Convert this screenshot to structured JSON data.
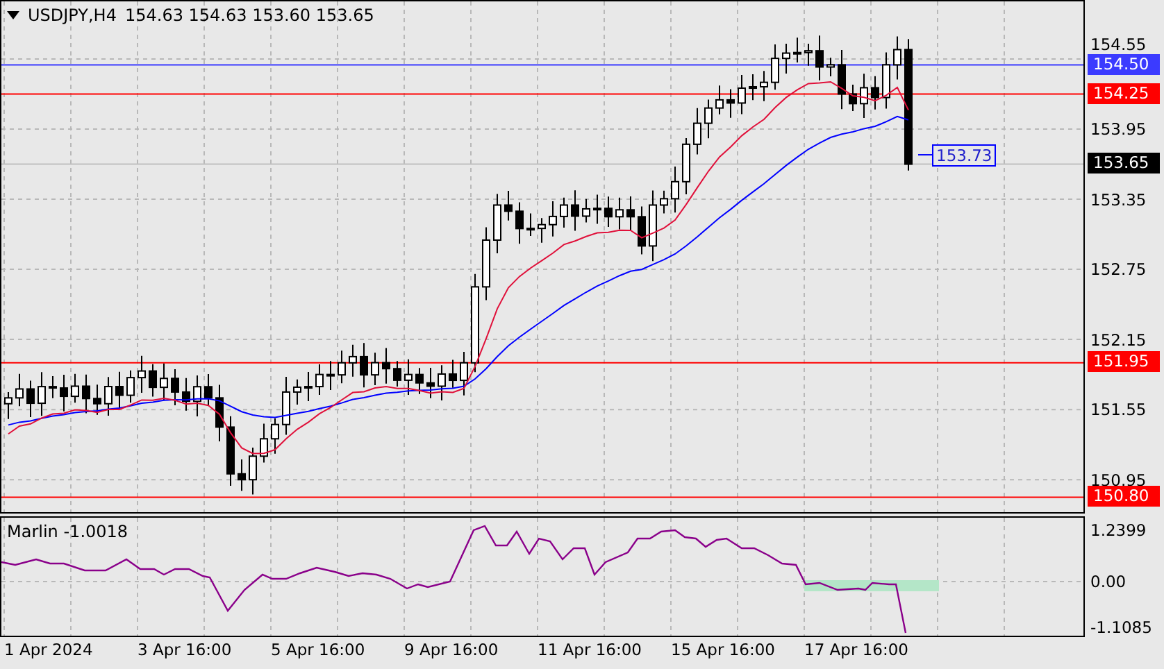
{
  "header": {
    "symbol": "USDJPY,H4",
    "ohlc": "154.63 154.63 153.60 153.65"
  },
  "price_axis": {
    "ticks": [
      "154.55",
      "153.95",
      "153.35",
      "152.75",
      "152.15",
      "151.55",
      "150.95"
    ]
  },
  "levels": [
    {
      "price": "154.50",
      "color": "#3b3bff"
    },
    {
      "price": "154.25",
      "color": "#ff0000"
    },
    {
      "price": "151.95",
      "color": "#ff0000"
    },
    {
      "price": "150.80",
      "color": "#ff0000"
    }
  ],
  "current_price": "153.65",
  "ma_label": "153.73",
  "indicator": {
    "title": "Marlin -1.0018",
    "ticks": [
      "1.2399",
      "0.00",
      "-1.1085"
    ]
  },
  "time_axis": {
    "labels": [
      "1 Apr 2024",
      "3 Apr 16:00",
      "5 Apr 16:00",
      "9 Apr 16:00",
      "11 Apr 16:00",
      "15 Apr 16:00",
      "17 Apr 16:00"
    ]
  }
}
